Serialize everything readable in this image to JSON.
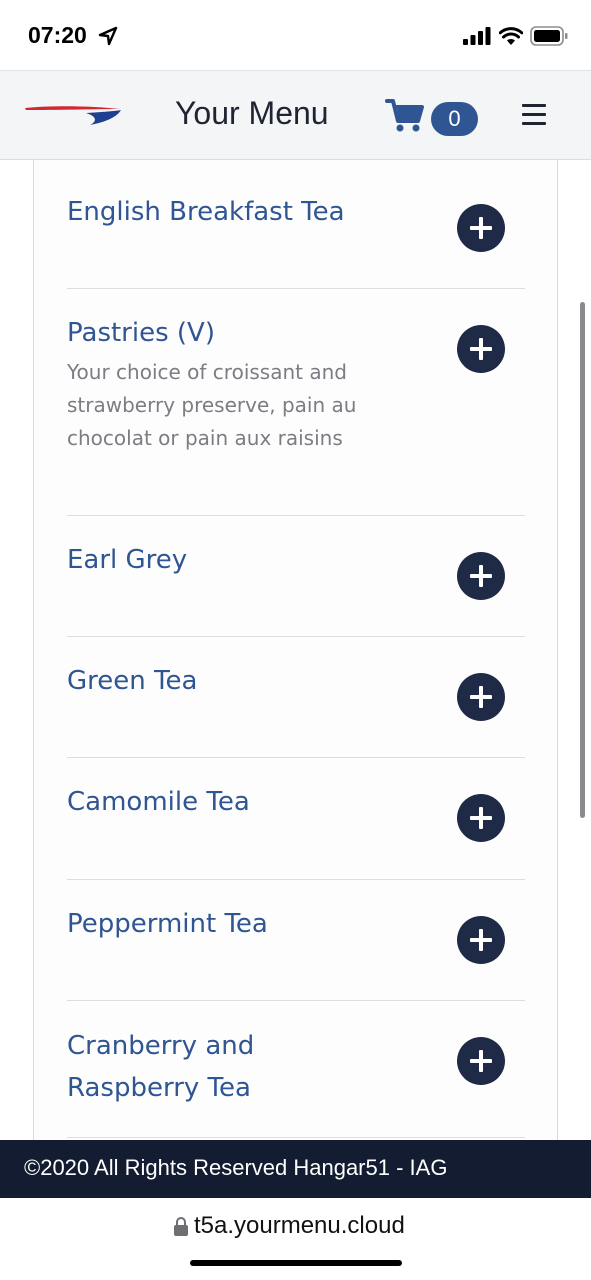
{
  "status_bar": {
    "time": "07:20",
    "icons": [
      "location-arrow-icon",
      "signal-icon",
      "wifi-icon",
      "battery-icon"
    ]
  },
  "header": {
    "logo": "british-airways-speedmarque-logo",
    "title": "Your Menu",
    "cart_icon": "shopping-cart-icon",
    "cart_count": "0",
    "menu_icon": "hamburger-menu-icon",
    "colors": {
      "accent": "#2f5593",
      "dark": "#1f2a47"
    }
  },
  "menu": {
    "items": [
      {
        "name": "English Breakfast Tea",
        "description": ""
      },
      {
        "name": "Pastries (V)",
        "description": "Your choice of croissant and strawberry preserve, pain au chocolat or pain aux raisins"
      },
      {
        "name": "Earl Grey",
        "description": ""
      },
      {
        "name": "Green Tea",
        "description": ""
      },
      {
        "name": "Camomile Tea",
        "description": ""
      },
      {
        "name": "Peppermint Tea",
        "description": ""
      },
      {
        "name": "Cranberry and Raspberry Tea",
        "description": ""
      }
    ],
    "add_icon": "plus-circle-icon"
  },
  "footer": {
    "copyright": "©2020 All Rights Reserved Hangar51 - IAG"
  },
  "browser": {
    "url": "t5a.yourmenu.cloud",
    "lock_icon": "lock-icon"
  }
}
